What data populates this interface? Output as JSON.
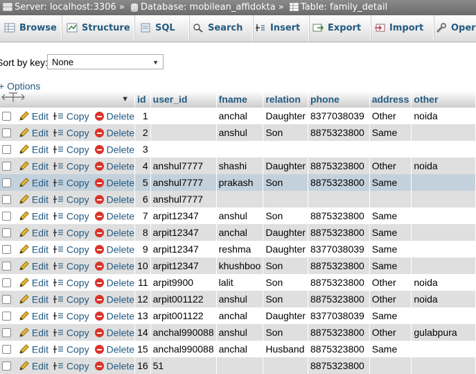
{
  "breadcrumb": {
    "server": "Server: localhost:3306",
    "sep1": "»",
    "database": "Database: mobilean_affidokta",
    "sep2": "»",
    "table": "Table: family_detail"
  },
  "tabs": [
    {
      "label": "Browse",
      "icon": "browse-icon"
    },
    {
      "label": "Structure",
      "icon": "structure-icon"
    },
    {
      "label": "SQL",
      "icon": "sql-icon"
    },
    {
      "label": "Search",
      "icon": "search-icon"
    },
    {
      "label": "Insert",
      "icon": "insert-icon"
    },
    {
      "label": "Export",
      "icon": "export-icon"
    },
    {
      "label": "Import",
      "icon": "import-icon"
    },
    {
      "label": "Oper",
      "icon": "wrench-icon"
    }
  ],
  "sort": {
    "label": "Sort by key:",
    "value": "None"
  },
  "options_label": "+ Options",
  "table": {
    "columns": [
      "id",
      "user_id",
      "fname",
      "relation",
      "phone",
      "address",
      "other"
    ],
    "action_labels": {
      "edit": "Edit",
      "copy": "Copy",
      "delete": "Delete"
    },
    "highlight_row": 4,
    "rows": [
      [
        "1",
        "",
        "anchal",
        "Daughter",
        "8377038039",
        "Other",
        "noida"
      ],
      [
        "2",
        "",
        "anshul",
        "Son",
        "8875323800",
        "Same",
        ""
      ],
      [
        "3",
        "",
        "",
        "",
        "",
        "",
        ""
      ],
      [
        "4",
        "anshul7777",
        "shashi",
        "Daughter",
        "8875323800",
        "Other",
        "noida"
      ],
      [
        "5",
        "anshul7777",
        "prakash",
        "Son",
        "8875323800",
        "Same",
        ""
      ],
      [
        "6",
        "anshul7777",
        "",
        "",
        "",
        "",
        ""
      ],
      [
        "7",
        "arpit12347",
        "anshul",
        "Son",
        "8875323800",
        "Same",
        ""
      ],
      [
        "8",
        "arpit12347",
        "anchal",
        "Daughter",
        "8875323800",
        "Same",
        ""
      ],
      [
        "9",
        "arpit12347",
        "reshma",
        "Daughter",
        "8377038039",
        "Same",
        ""
      ],
      [
        "10",
        "arpit12347",
        "khushboo",
        "Son",
        "8875323800",
        "Same",
        ""
      ],
      [
        "11",
        "arpit9900",
        "lalit",
        "Son",
        "8875323800",
        "Other",
        "noida"
      ],
      [
        "12",
        "arpit001122",
        "anshul",
        "Son",
        "8875323800",
        "Other",
        "noida"
      ],
      [
        "13",
        "arpit001122",
        "anchal",
        "Daughter",
        "8377038039",
        "Same",
        ""
      ],
      [
        "14",
        "anchal990088",
        "anshul",
        "Son",
        "8875323800",
        "Other",
        "gulabpura"
      ],
      [
        "15",
        "anchal990088",
        "anchal",
        "Husband",
        "8875323800",
        "Same",
        ""
      ],
      [
        "16",
        "51",
        "",
        "",
        "8875323800",
        "",
        ""
      ]
    ]
  },
  "colors": {
    "link": "#235a81",
    "row_even": "#dfdfdf",
    "row_highlight": "#c3d1dc",
    "delete": "#d9342b"
  }
}
